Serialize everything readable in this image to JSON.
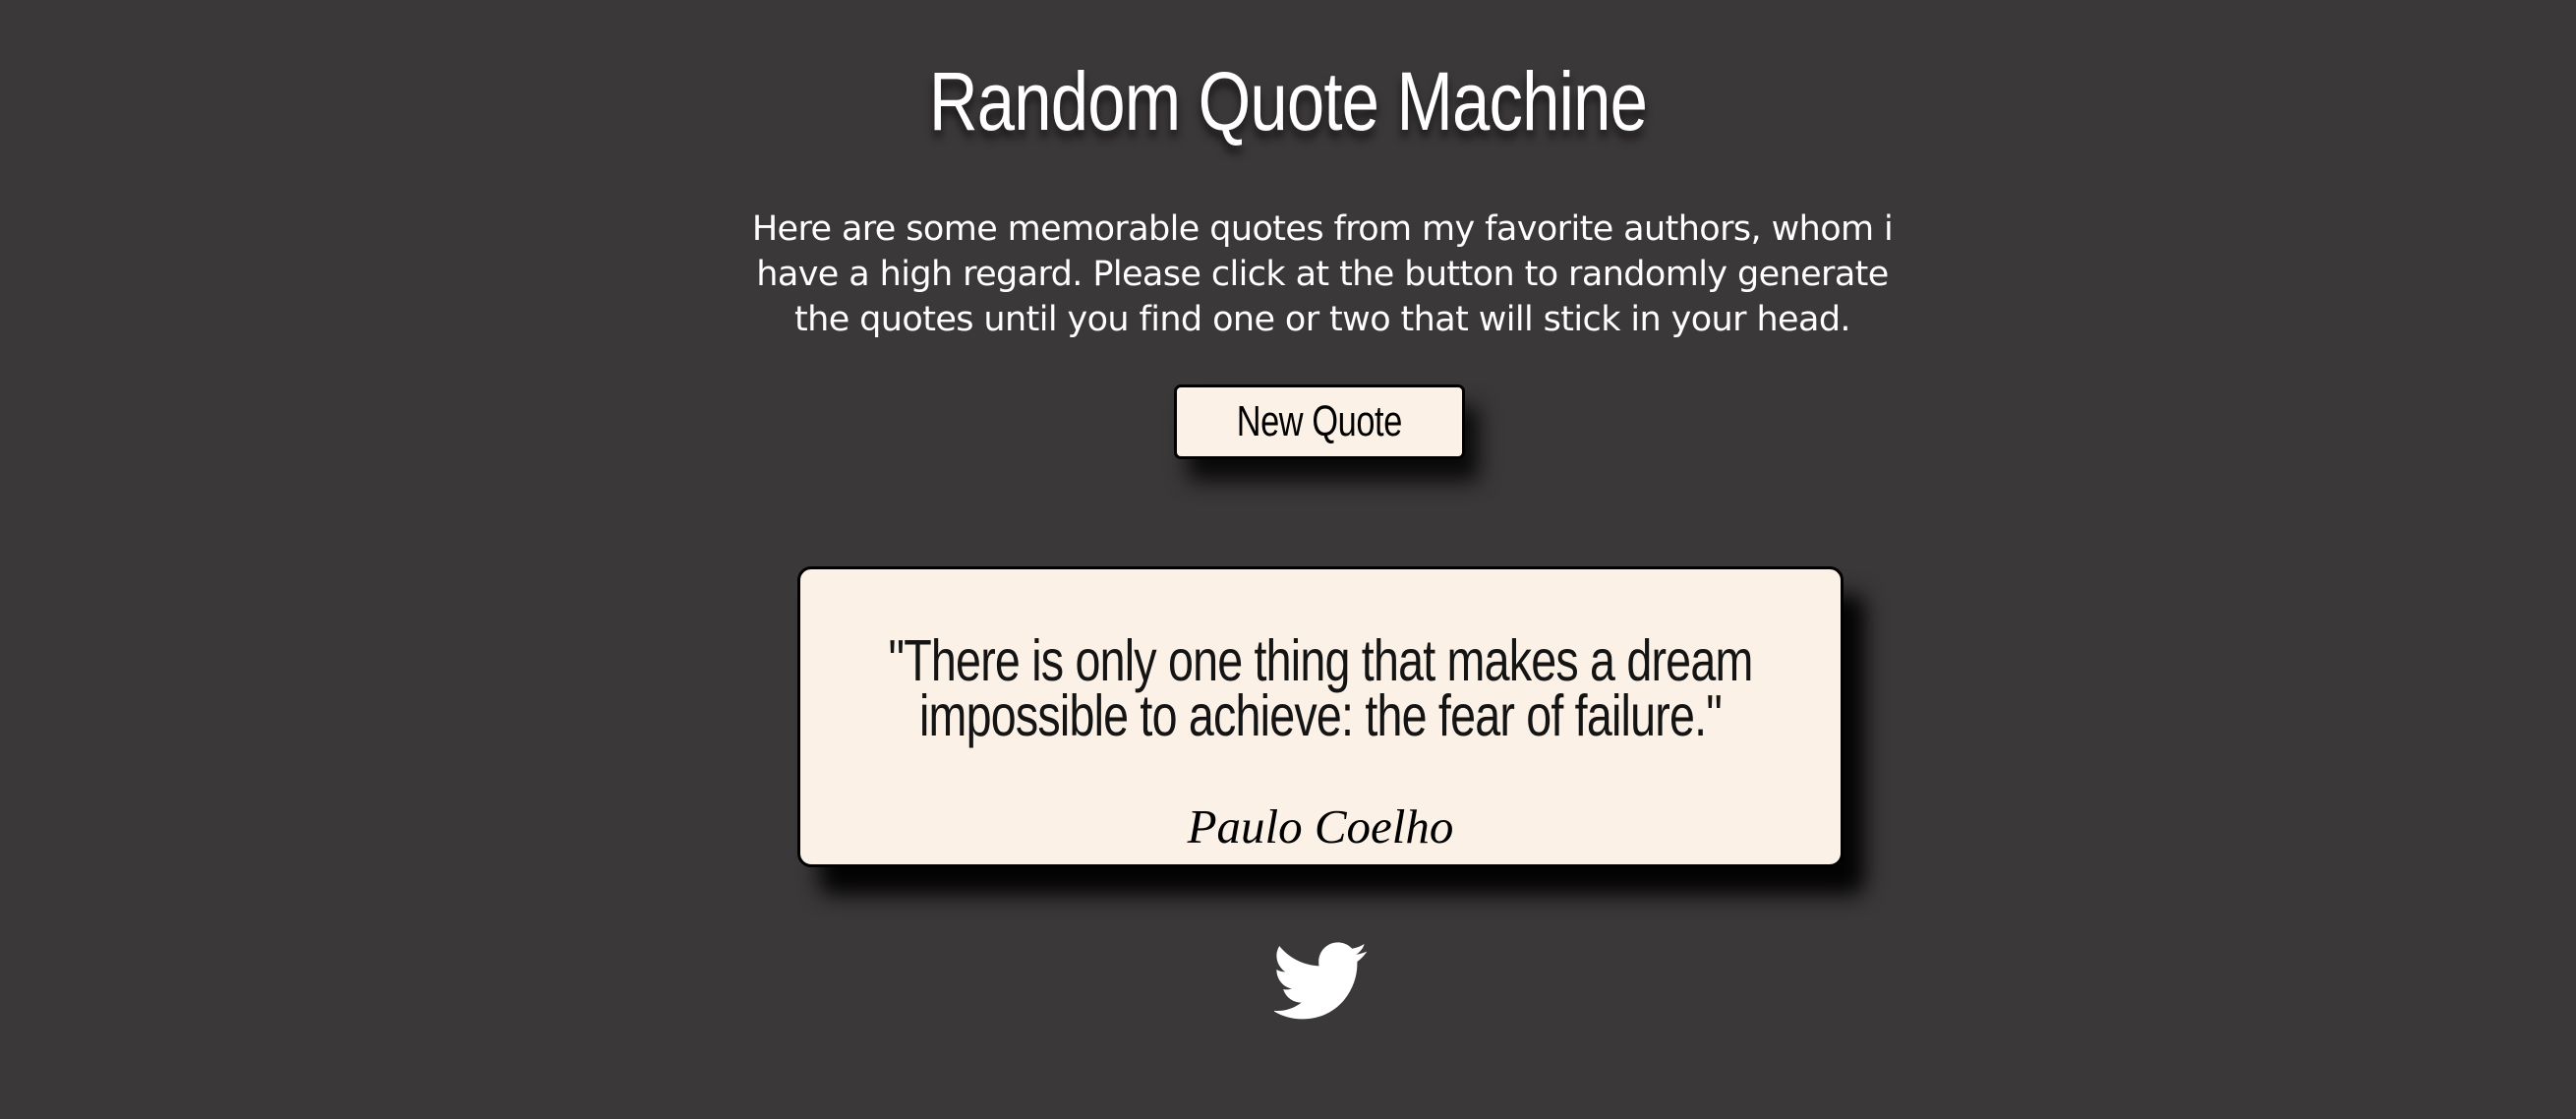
{
  "page": {
    "title": "Random Quote Machine",
    "intro": "Here are some memorable quotes from my favorite authors, whom i have a high regard. Please click at the button to randomly generate the quotes until you find one or two that will stick in your head.",
    "background_color": "#3b3839"
  },
  "controls": {
    "new_quote_label": "New Quote"
  },
  "quote": {
    "text": "\"There is only one thing that makes a dream impossible to achieve: the fear of failure.\"",
    "author": "Paulo Coelho",
    "box_color": "#fcf1e6"
  },
  "share": {
    "icon": "twitter-icon",
    "icon_color": "#ffffff"
  }
}
